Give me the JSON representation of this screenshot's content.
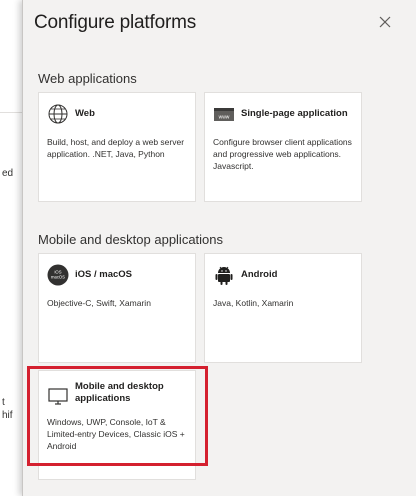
{
  "background": {
    "fragments": [
      "ed",
      "t",
      "hif"
    ]
  },
  "panel": {
    "title": "Configure platforms"
  },
  "sections": [
    {
      "heading": "Web applications",
      "tiles": [
        {
          "title": "Web",
          "description": "Build, host, and deploy a web server application. .NET, Java, Python",
          "icon": "globe-icon"
        },
        {
          "title": "Single-page application",
          "description": "Configure browser client applications and progressive web applications. Javascript.",
          "icon": "browser-window-icon"
        }
      ]
    },
    {
      "heading": "Mobile and desktop applications",
      "tiles": [
        {
          "title": "iOS / macOS",
          "description": "Objective-C, Swift, Xamarin",
          "icon": "ios-macos-icon",
          "icon_text": "iOS\nmacOS"
        },
        {
          "title": "Android",
          "description": "Java, Kotlin, Xamarin",
          "icon": "android-icon"
        },
        {
          "title": "Mobile and desktop applications",
          "description": "Windows, UWP, Console, IoT & Limited-entry Devices, Classic iOS + Android",
          "icon": "desktop-monitor-icon",
          "highlighted": true
        }
      ]
    }
  ],
  "colors": {
    "panel_bg": "#f3f2f1",
    "highlight": "#d4202f"
  }
}
